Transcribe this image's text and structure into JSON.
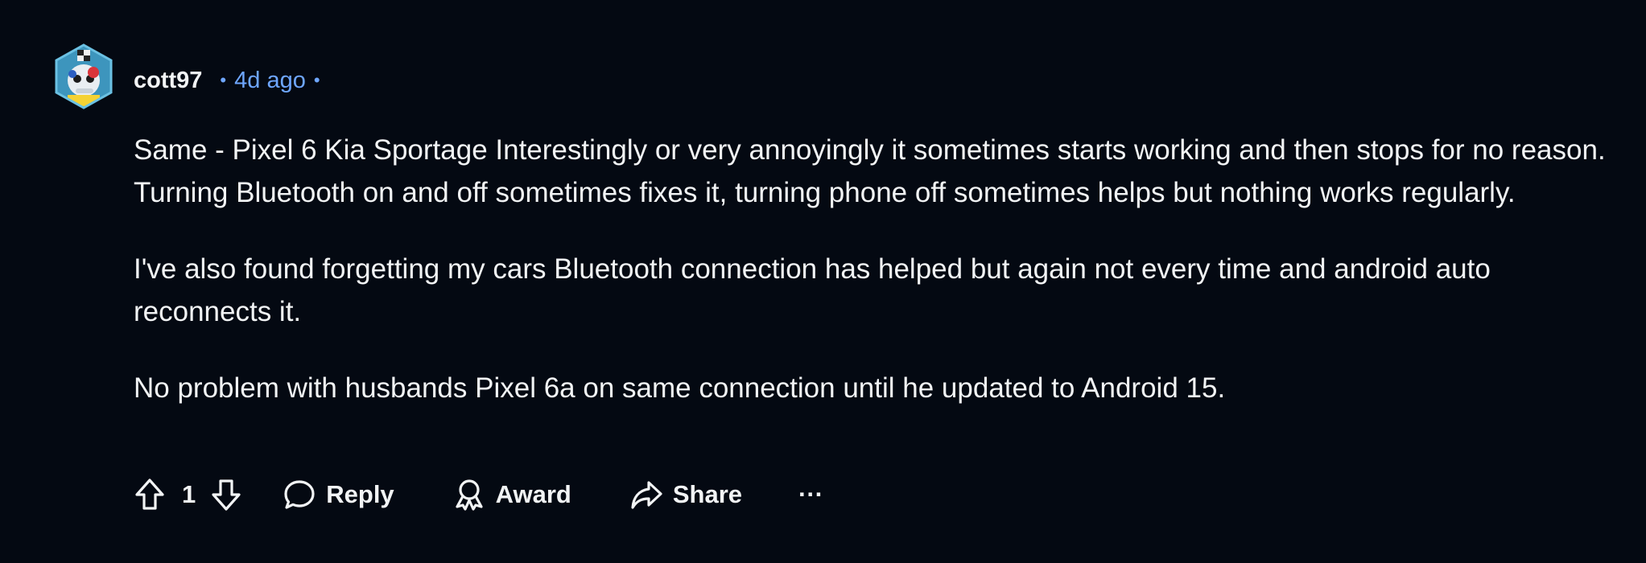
{
  "comment": {
    "author": "cott97",
    "separator_before": "•",
    "time": "4d ago",
    "separator_after": "•",
    "paragraphs": [
      "Same - Pixel 6 Kia Sportage Interestingly or very annoyingly it sometimes starts working and then stops for no reason. Turning Bluetooth on and off sometimes fixes it, turning phone off sometimes helps but nothing works regularly.",
      "I've also found forgetting my cars Bluetooth connection has helped but again not every time and android auto reconnects it.",
      "No problem with husbands Pixel 6a on same connection until he updated to Android 15."
    ]
  },
  "actions": {
    "score": "1",
    "reply_label": "Reply",
    "award_label": "Award",
    "share_label": "Share",
    "more_label": "···"
  },
  "icons": {
    "upvote": "upvote-arrow-icon",
    "downvote": "downvote-arrow-icon",
    "reply": "speech-bubble-icon",
    "award": "award-ribbon-icon",
    "share": "share-arrow-icon",
    "more": "ellipsis-icon"
  },
  "colors": {
    "background": "#040912",
    "text": "#f2f4f5",
    "timestamp": "#6ea6ff"
  }
}
